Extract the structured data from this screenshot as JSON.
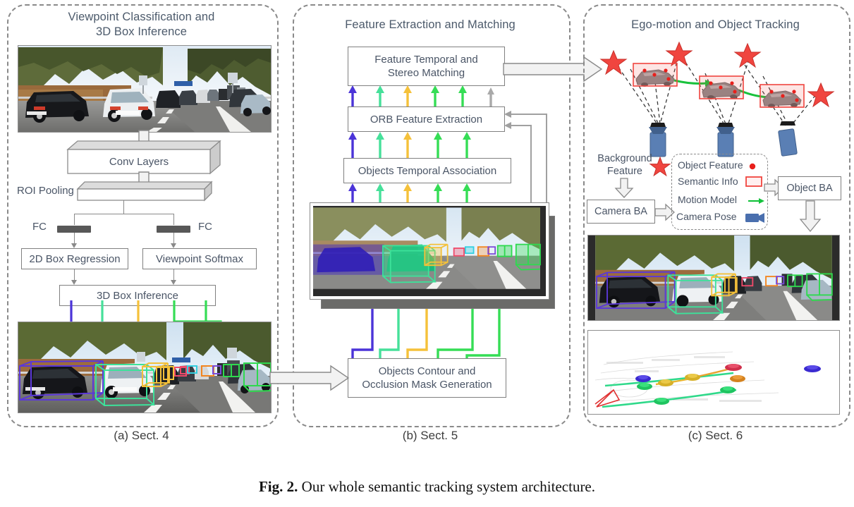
{
  "figure": {
    "caption_prefix": "Fig. 2.",
    "caption_text": " Our whole semantic tracking system architecture."
  },
  "panels": [
    {
      "id": "a",
      "title_line1": "Viewpoint Classification and",
      "title_line2": "3D Box Inference",
      "caption": "(a) Sect. 4",
      "nodes": [
        {
          "name": "conv-layers",
          "label": "Conv Layers"
        },
        {
          "name": "roi-pooling",
          "label": "ROI Pooling"
        },
        {
          "name": "fc-left",
          "label": "FC"
        },
        {
          "name": "fc-right",
          "label": "FC"
        },
        {
          "name": "box-2d-regression",
          "label": "2D Box Regression"
        },
        {
          "name": "viewpoint-softmax",
          "label": "Viewpoint Softmax"
        },
        {
          "name": "box-3d-inference",
          "label": "3D Box Inference"
        }
      ],
      "images": [
        {
          "name": "input-highway-frame",
          "alt": "highway traffic camera frame"
        },
        {
          "name": "detected-3d-boxes-frame",
          "alt": "highway frame with coloured 3D bounding boxes"
        }
      ]
    },
    {
      "id": "b",
      "title_line1": "Feature Extraction and Matching",
      "title_line2": "",
      "caption": "(b) Sect. 5",
      "nodes": [
        {
          "name": "feature-temporal-stereo-matching",
          "label_line1": "Feature Temporal and",
          "label_line2": "Stereo Matching"
        },
        {
          "name": "orb-feature-extraction",
          "label_line1": "ORB Feature Extraction",
          "label_line2": ""
        },
        {
          "name": "objects-temporal-association",
          "label_line1": "Objects Temporal Association",
          "label_line2": ""
        },
        {
          "name": "objects-contour-occlusion-mask",
          "label_line1": "Objects Contour and",
          "label_line2": "Occlusion Mask Generation"
        }
      ],
      "images": [
        {
          "name": "segmentation-mask-frames",
          "alt": "stacked highway frames with coloured object masks"
        }
      ]
    },
    {
      "id": "c",
      "title_line1": "Ego-motion and Object Tracking",
      "title_line2": "",
      "caption": "(c) Sect. 6",
      "nodes": [
        {
          "name": "background-feature-label",
          "label_line1": "Background",
          "label_line2": "Feature"
        },
        {
          "name": "camera-ba",
          "label_line1": "Camera BA",
          "label_line2": ""
        },
        {
          "name": "object-ba",
          "label_line1": "Object BA",
          "label_line2": ""
        }
      ],
      "legend": {
        "name": "tracking-legend",
        "items": [
          {
            "label": "Object Feature",
            "glyph": "red-dot-icon"
          },
          {
            "label": "Semantic Info",
            "glyph": "red-rect-icon"
          },
          {
            "label": "Motion Model",
            "glyph": "green-arrow-icon"
          },
          {
            "label": "Camera Pose",
            "glyph": "blue-camera-icon"
          }
        ]
      },
      "images": [
        {
          "name": "tracking-result-frame",
          "alt": "highway frame with tracked 3D boxes"
        },
        {
          "name": "birdseye-trajectory-map",
          "alt": "bird's eye trajectory map with coloured car icons"
        }
      ]
    }
  ],
  "colors": {
    "text": "#4a5566",
    "panel_border": "#8a8a8a",
    "box_border": "#808080",
    "stream_blue": "#4b34d8",
    "stream_light_green": "#46e09a",
    "stream_yellow": "#f5c13a",
    "stream_green": "#35dd55",
    "stream_gray": "#a9a9a9",
    "legend_red": "#e8293a",
    "legend_green": "#14c23c",
    "legend_blue": "#4a6fae",
    "block_arrow_fill": "#f2f2f2",
    "block_arrow_stroke": "#8a8a8a"
  }
}
